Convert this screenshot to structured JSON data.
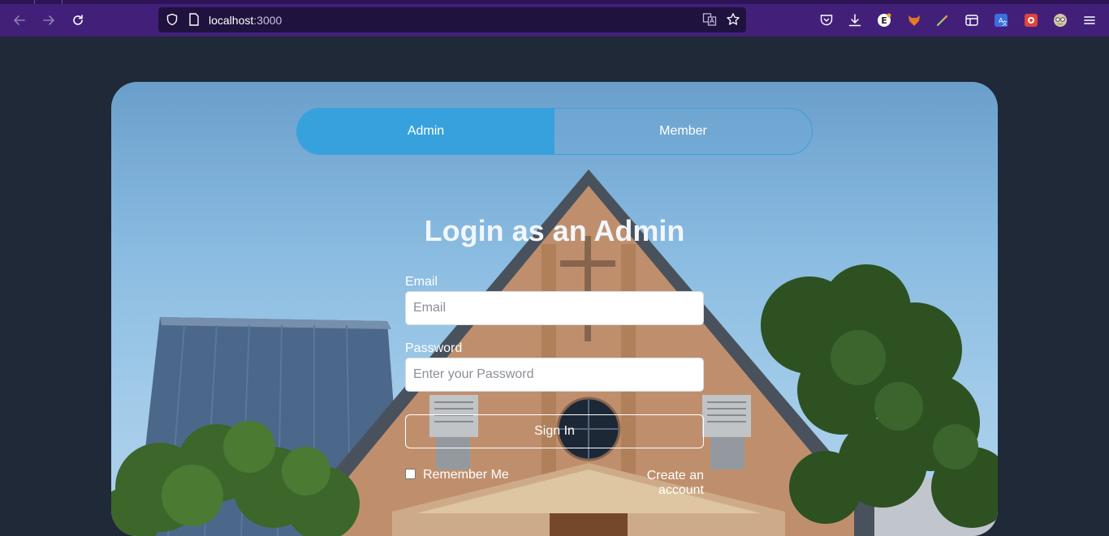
{
  "browser": {
    "url_host": "localhost",
    "url_port": ":3000"
  },
  "tabs": {
    "admin_label": "Admin",
    "member_label": "Member",
    "active": "admin"
  },
  "form": {
    "title": "Login as an Admin",
    "email_label": "Email",
    "email_placeholder": "Email",
    "password_label": "Password",
    "password_placeholder": "Enter your Password",
    "signin_label": "Sign In",
    "remember_label": "Remember Me",
    "remember_checked": false,
    "create_account_label": "Create an account"
  },
  "colors": {
    "page_bg": "#1f2937",
    "browser_bar": "#42207a",
    "urlbar": "#20123e",
    "accent_blue": "#37a1dd"
  },
  "icons": {
    "back": "arrow-left-icon",
    "forward": "arrow-right-icon",
    "reload": "reload-icon",
    "shield": "shield-icon",
    "page": "page-icon",
    "translate": "translate-icon",
    "bookmark": "star-icon",
    "pocket": "pocket-icon",
    "downloads": "download-icon",
    "menu": "hamburger-menu-icon"
  }
}
